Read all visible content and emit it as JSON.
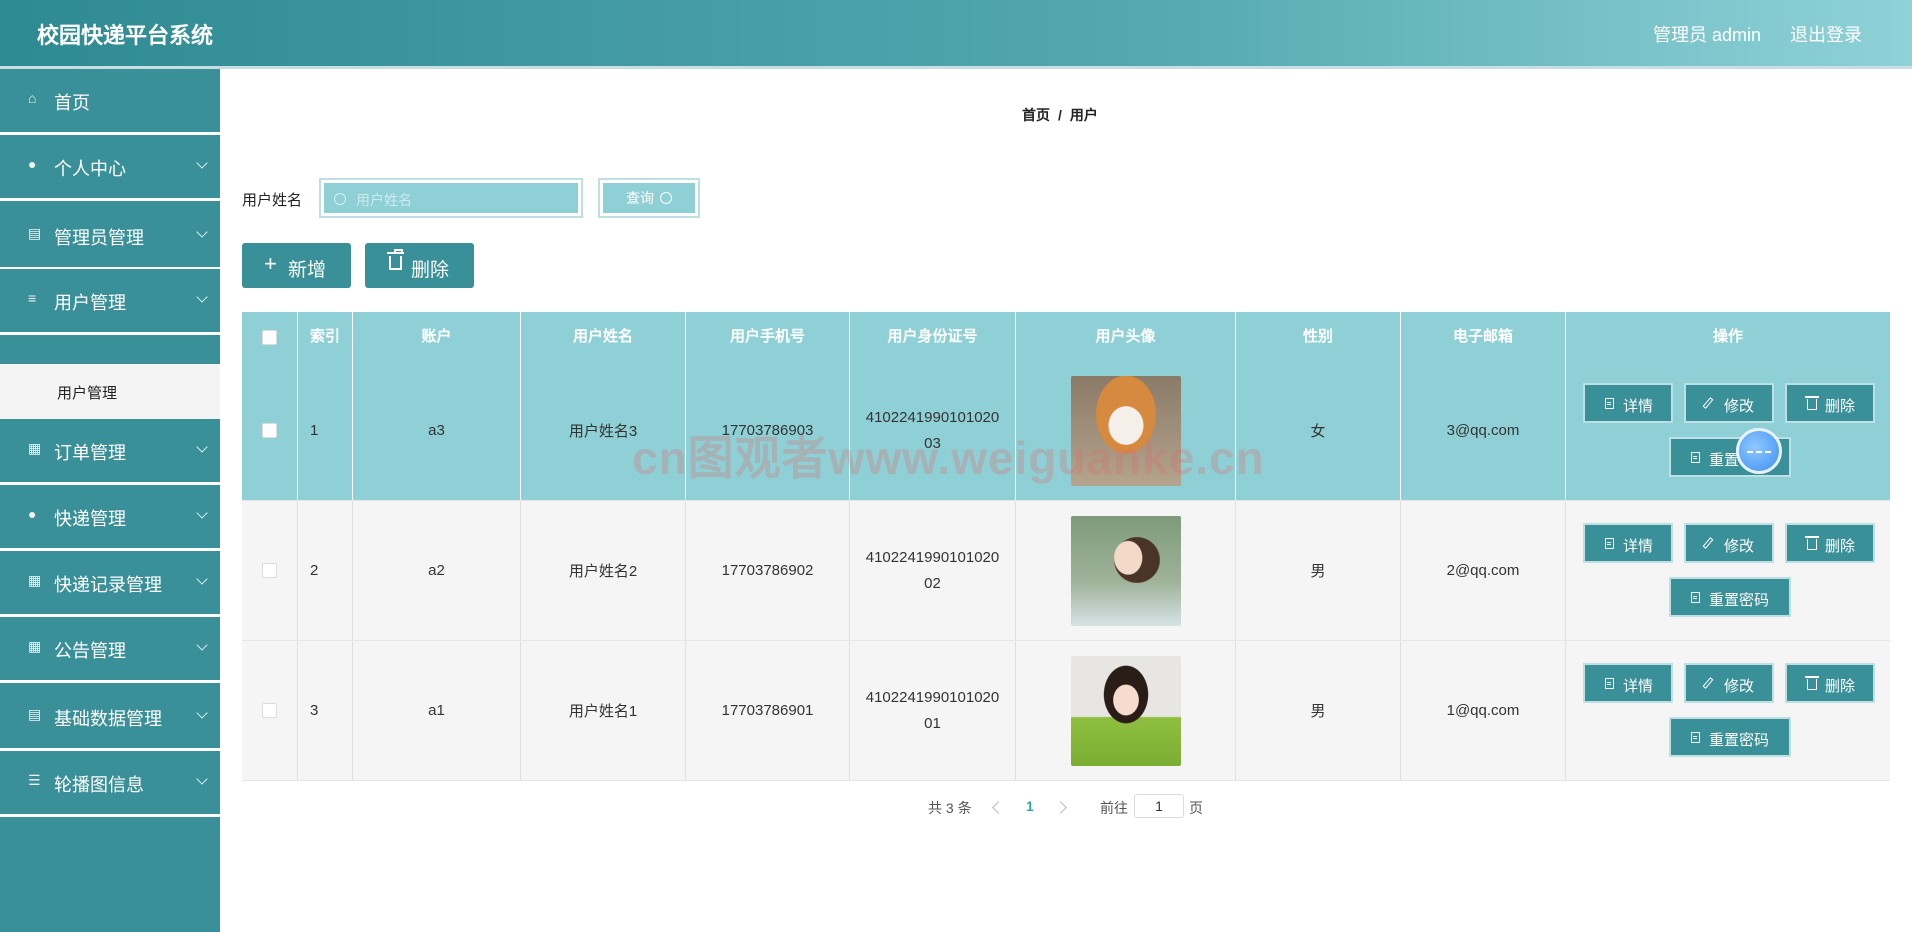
{
  "header": {
    "title": "校园快递平台系统",
    "user": "管理员 admin",
    "logout": "退出登录"
  },
  "sidebar": {
    "items": [
      {
        "label": "首页",
        "icon": "home-icon",
        "glyph": "⌂",
        "has_chevron": false
      },
      {
        "label": "个人中心",
        "icon": "user-icon",
        "glyph": "●",
        "has_chevron": true
      },
      {
        "label": "管理员管理",
        "icon": "clipboard-icon",
        "glyph": "▤",
        "has_chevron": true
      },
      {
        "label": "用户管理",
        "icon": "list-icon",
        "glyph": "≡",
        "has_chevron": true
      },
      {
        "label": "订单管理",
        "icon": "grid-icon",
        "glyph": "▦",
        "has_chevron": true
      },
      {
        "label": "快递管理",
        "icon": "location-pin-icon",
        "glyph": "●",
        "has_chevron": true
      },
      {
        "label": "快递记录管理",
        "icon": "grid-icon",
        "glyph": "▦",
        "has_chevron": true
      },
      {
        "label": "公告管理",
        "icon": "grid-icon",
        "glyph": "▦",
        "has_chevron": true
      },
      {
        "label": "基础数据管理",
        "icon": "clipboard-icon",
        "glyph": "▤",
        "has_chevron": true
      },
      {
        "label": "轮播图信息",
        "icon": "sliders-icon",
        "glyph": "☰",
        "has_chevron": true
      }
    ],
    "active_sub": "用户管理"
  },
  "breadcrumb": {
    "home": "首页",
    "sep": "/",
    "current": "用户"
  },
  "search": {
    "label": "用户姓名",
    "placeholder": "用户姓名",
    "value": "",
    "button": "查询"
  },
  "actions": {
    "add": "新增",
    "delete": "删除"
  },
  "table": {
    "headers": [
      "索引",
      "账户",
      "用户姓名",
      "用户手机号",
      "用户身份证号",
      "用户头像",
      "性别",
      "电子邮箱",
      "操作"
    ],
    "rows": [
      {
        "index": "1",
        "account": "a3",
        "name": "用户姓名3",
        "phone": "17703786903",
        "id_card": "410224199010102003",
        "avatar": "shiba-dog-photo",
        "gender": "女",
        "email": "3@qq.com"
      },
      {
        "index": "2",
        "account": "a2",
        "name": "用户姓名2",
        "phone": "17703786902",
        "id_card": "410224199010102002",
        "avatar": "girl-profile-photo",
        "gender": "男",
        "email": "2@qq.com"
      },
      {
        "index": "3",
        "account": "a1",
        "name": "用户姓名1",
        "phone": "17703786901",
        "id_card": "410224199010102001",
        "avatar": "girl-green-sweater-photo",
        "gender": "男",
        "email": "1@qq.com"
      }
    ],
    "row_actions": {
      "detail": "详情",
      "edit": "修改",
      "delete": "删除",
      "reset": "重置密码"
    }
  },
  "pagination": {
    "total": "共 3 条",
    "current": "1",
    "goto": "前往",
    "goto_value": "1",
    "page": "页"
  },
  "watermark": "cn图观者www.weiguanke.cn",
  "colors": {
    "primary": "#3a9098",
    "header_light": "#8fd2d8",
    "table_header": "#8fd0d6",
    "highlight_row": "#8fd0d6"
  }
}
